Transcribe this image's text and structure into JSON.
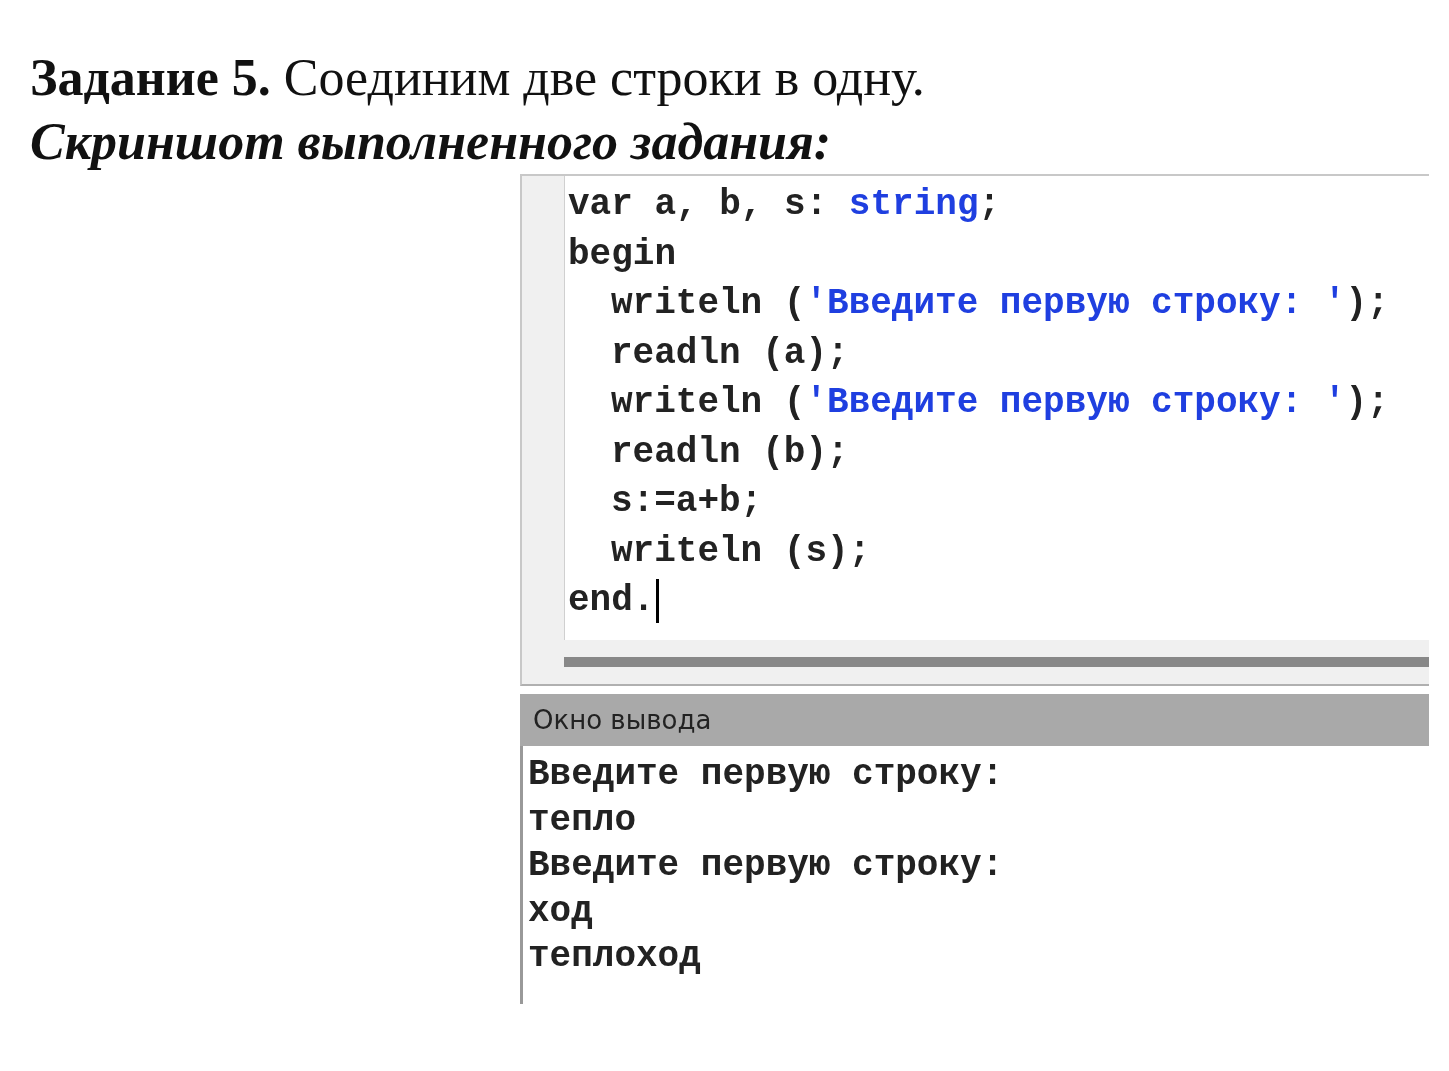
{
  "heading": {
    "task": "Задание 5.",
    "text": " Соединим две строки в одну.",
    "subtitle": "Скриншот выполненного задания:"
  },
  "editor": {
    "lines": [
      {
        "tokens": [
          {
            "kind": "plain",
            "text": "var a, b, s: "
          },
          {
            "kind": "type",
            "text": "string"
          },
          {
            "kind": "plain",
            "text": ";"
          }
        ],
        "caret": false
      },
      {
        "tokens": [
          {
            "kind": "keyword",
            "text": "begin"
          }
        ],
        "caret": false,
        "children": [
          {
            "tokens": [
              {
                "kind": "plain",
                "text": "writeln ("
              },
              {
                "kind": "string",
                "text": "'Введите первую строку: '"
              },
              {
                "kind": "plain",
                "text": ");"
              }
            ],
            "caret": false
          },
          {
            "tokens": [
              {
                "kind": "plain",
                "text": "readln (a);"
              }
            ],
            "caret": false
          },
          {
            "tokens": [
              {
                "kind": "plain",
                "text": "writeln ("
              },
              {
                "kind": "string",
                "text": "'Введите первую строку: '"
              },
              {
                "kind": "plain",
                "text": ");"
              }
            ],
            "caret": false
          },
          {
            "tokens": [
              {
                "kind": "plain",
                "text": "readln (b);"
              }
            ],
            "caret": false
          },
          {
            "tokens": [
              {
                "kind": "plain",
                "text": "s:=a+b;"
              }
            ],
            "caret": false
          },
          {
            "tokens": [
              {
                "kind": "plain",
                "text": "writeln (s);"
              }
            ],
            "caret": false
          }
        ]
      },
      {
        "tokens": [
          {
            "kind": "keyword",
            "text": "end"
          },
          {
            "kind": "plain",
            "text": "."
          }
        ],
        "caret": true
      }
    ]
  },
  "output": {
    "title": "Окно вывода",
    "lines": [
      "Введите первую строку:",
      "тепло",
      "Введите первую строку:",
      "ход",
      "теплоход"
    ]
  }
}
